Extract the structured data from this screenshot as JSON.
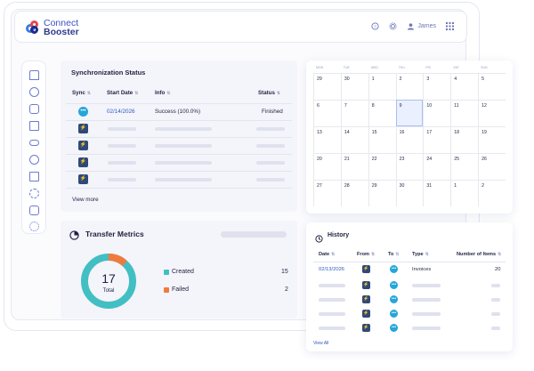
{
  "brand": {
    "line1": "Connect",
    "line2": "Booster",
    "colors": [
      "#3b7be0",
      "#e5484d",
      "#1d2b8f"
    ]
  },
  "header": {
    "user_name": "James",
    "icons": [
      "help-icon",
      "gear-icon",
      "user-icon",
      "apps-grid-icon"
    ]
  },
  "sidebar": {
    "icons": [
      "home-icon",
      "users-icon",
      "document-icon",
      "folder-icon",
      "link-icon",
      "clock-icon",
      "building-icon",
      "sync-icon",
      "calendar-icon",
      "settings-icon"
    ]
  },
  "sync": {
    "title": "Synchronization Status",
    "headers": [
      "Sync",
      "Start Date",
      "Info",
      "Status"
    ],
    "first_row": {
      "date": "02/14/2026",
      "info": "Success (100.0%)",
      "status": "Finished"
    },
    "view_more": "View more"
  },
  "metrics": {
    "title": "Transfer Metrics",
    "total": "17",
    "total_label": "Total",
    "items": [
      {
        "label": "Created",
        "value": "15",
        "color": "#42bfc3"
      },
      {
        "label": "Failed",
        "value": "2",
        "color": "#f07a3e"
      }
    ]
  },
  "calendar": {
    "days": [
      "MON",
      "TUE",
      "WED",
      "THU",
      "FRI",
      "SAT",
      "SUN"
    ],
    "weeks": [
      [
        "29",
        "30",
        "1",
        "2",
        "3",
        "4",
        "5"
      ],
      [
        "6",
        "7",
        "8",
        "9",
        "10",
        "11",
        "12"
      ],
      [
        "13",
        "14",
        "15",
        "16",
        "17",
        "18",
        "19"
      ],
      [
        "20",
        "21",
        "22",
        "23",
        "24",
        "25",
        "26"
      ],
      [
        "27",
        "28",
        "29",
        "30",
        "31",
        "1",
        "2"
      ]
    ],
    "selected": "9"
  },
  "history": {
    "title": "History",
    "headers": [
      "Date",
      "From",
      "To",
      "Type",
      "Number of Items"
    ],
    "first_row": {
      "date": "02/13/2026",
      "type": "Invoices",
      "count": "20"
    },
    "view_all": "View All"
  }
}
